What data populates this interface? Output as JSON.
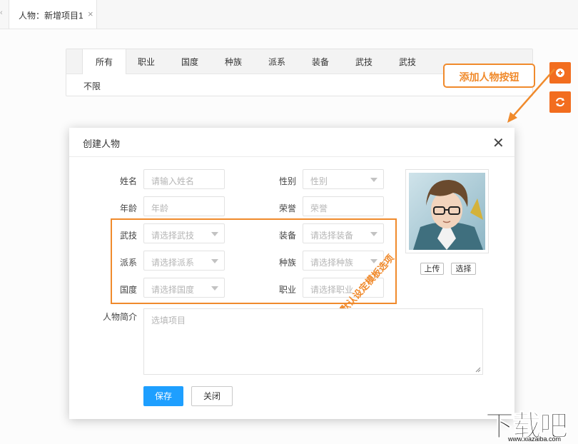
{
  "doc_tab": {
    "label": "人物：新增项目1",
    "close": "×",
    "scroll_left": "‹"
  },
  "filter": {
    "tabs": [
      "所有",
      "职业",
      "国度",
      "种族",
      "派系",
      "装备",
      "武技",
      "武技"
    ],
    "active_tab": "所有",
    "value": "不限"
  },
  "fab": {
    "add_icon": "plus-circle-icon",
    "refresh_icon": "refresh-icon"
  },
  "annotations": {
    "add_button_callout": "添加人物按钮",
    "template_note": "默认设定模板选项",
    "accent_color": "#f08a2c"
  },
  "modal": {
    "title": "创建人物",
    "close": "✕",
    "name": {
      "label": "姓名",
      "placeholder": "请输入姓名"
    },
    "gender": {
      "label": "性别",
      "placeholder": "性别"
    },
    "age": {
      "label": "年龄",
      "placeholder": "年龄"
    },
    "honor": {
      "label": "荣誉",
      "placeholder": "荣誉"
    },
    "martial": {
      "label": "武技",
      "placeholder": "请选择武技"
    },
    "equipment": {
      "label": "装备",
      "placeholder": "请选择装备"
    },
    "faction": {
      "label": "派系",
      "placeholder": "请选择派系"
    },
    "race": {
      "label": "种族",
      "placeholder": "请选择种族"
    },
    "country": {
      "label": "国度",
      "placeholder": "请选择国度"
    },
    "profession": {
      "label": "职业",
      "placeholder": "请选择职业"
    },
    "bio": {
      "label": "人物简介",
      "placeholder": "选填项目"
    },
    "upload_label": "上传",
    "choose_label": "选择",
    "save_label": "保存",
    "close_label": "关闭",
    "primary_color": "#1e9fff"
  },
  "watermark": {
    "main": "下载吧",
    "sub": "www.xiazaiba.com"
  }
}
